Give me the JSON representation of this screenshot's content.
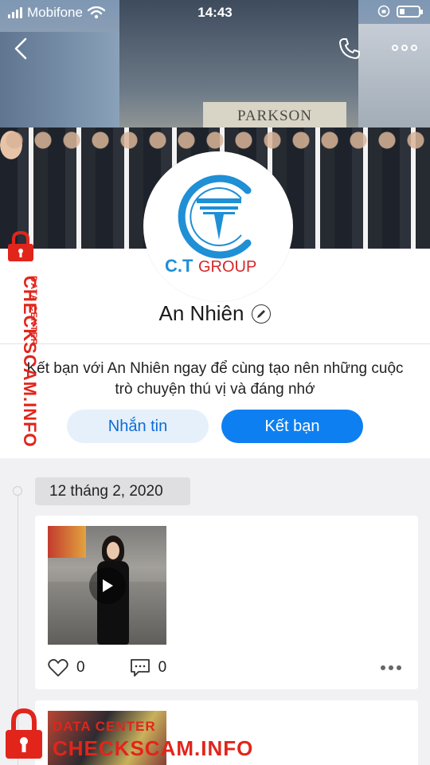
{
  "status_bar": {
    "carrier": "Mobifone",
    "time": "14:43",
    "signal_bars": 4
  },
  "cover": {
    "sign_text": "PARKSON"
  },
  "avatar": {
    "brand_text": "C.T GROUP",
    "brand_c": "C.T",
    "brand_group": "GROUP"
  },
  "profile": {
    "name": "An Nhiên",
    "description": "Kết bạn với An Nhiên ngay để cùng tạo nên những cuộc trò chuyện thú vị và đáng nhớ",
    "message_button": "Nhắn tin",
    "add_friend_button": "Kết bạn"
  },
  "timeline": {
    "date": "12 tháng 2, 2020",
    "post": {
      "likes": "0",
      "comments": "0"
    }
  },
  "watermark": {
    "brand": "CHECKSCAM.INFO",
    "sub": "DATA CENTER"
  },
  "colors": {
    "accent": "#0e7ff0",
    "watermark_red": "#e1251b",
    "brand_blue": "#1f8fd6",
    "brand_red": "#d6282a"
  },
  "icons": [
    "back-icon",
    "phone-icon",
    "more-icon",
    "wifi-icon",
    "battery-icon",
    "edit-icon",
    "play-icon",
    "heart-icon",
    "comment-icon",
    "lock-icon"
  ]
}
